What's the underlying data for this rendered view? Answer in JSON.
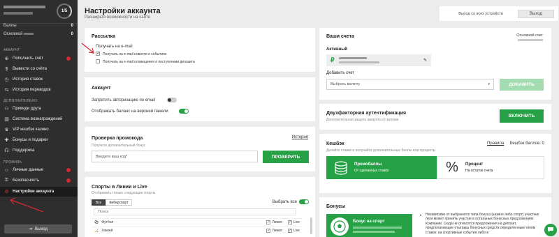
{
  "sidebar": {
    "level": "1/5",
    "rows": [
      {
        "label": "Баллы",
        "value": "0"
      },
      {
        "label": "Основной",
        "value": "0"
      }
    ],
    "sections": {
      "account": "АККАУНТ",
      "extra": "ДОПОЛНИТЕЛЬНО",
      "profile": "ПРОФИЛЬ"
    },
    "account_items": [
      {
        "label": "Пополнить счёт",
        "icon": "plus-circle-icon"
      },
      {
        "label": "Вывести со счёта",
        "icon": "dollar-icon"
      },
      {
        "label": "История ставок",
        "icon": "clock-icon"
      },
      {
        "label": "История переводов",
        "icon": "transfer-icon"
      }
    ],
    "extra_items": [
      {
        "label": "Приведи друга",
        "icon": "users-icon"
      },
      {
        "label": "Система вознаграждений",
        "icon": "chart-icon"
      },
      {
        "label": "VIP кешбэк казино",
        "icon": "vip-icon"
      },
      {
        "label": "Бонусы и подарки",
        "icon": "gift-icon"
      },
      {
        "label": "Поддержка",
        "icon": "support-icon"
      }
    ],
    "profile_items": [
      {
        "label": "Личные данные",
        "icon": "user-icon"
      },
      {
        "label": "Безопасность",
        "icon": "lock-icon"
      },
      {
        "label": "Настройки аккаунта",
        "icon": "settings-icon"
      }
    ],
    "logout": "Выход"
  },
  "header": {
    "title": "Настройки аккаунта",
    "subtitle": "Расширьте возможности на сайте",
    "exit_all_label": "Выход со всех устройств",
    "exit_button": "Выход"
  },
  "mailing": {
    "title": "Рассылка",
    "email_label": "Получать на e-mail",
    "options": [
      {
        "label": "Получать на e-mail новости о событиях",
        "checked": true
      },
      {
        "label": "Получать на e-mail оповещения о поступлении депозита",
        "checked": false
      }
    ]
  },
  "account": {
    "title": "Аккаунт",
    "toggles": [
      {
        "label": "Запретить авторизацию по email",
        "on": false
      },
      {
        "label": "Отображать баланс на верхней панели",
        "on": true
      }
    ]
  },
  "promo": {
    "title": "Проверка промокода",
    "history_link": "История",
    "subtitle": "Получите дополнительный бонус",
    "placeholder": "Введите ваш код*",
    "button": "ПРОВЕРИТЬ"
  },
  "sports": {
    "title": "Спорты в Линии и Live",
    "subtitle": "Отображать только следующие спорты",
    "tabs": [
      "Все",
      "Киберспорт"
    ],
    "select_all": "Выбрать все",
    "search_placeholder": "Поиск",
    "rows": [
      {
        "name": "Футбол",
        "line": "Линия",
        "live": "Live"
      },
      {
        "name": "Хоккей",
        "line": "Линия",
        "live": "Live"
      }
    ]
  },
  "accounts": {
    "title": "Ваши счета",
    "main_account": "Основной счет",
    "active_label": "Активный",
    "currency_symbol": "₽",
    "add_label": "Добавить счет",
    "select_placeholder": "Выбрать валюту",
    "add_button": "ДОБАВИТЬ"
  },
  "twofa": {
    "title": "Двухфакторная аутентификация",
    "subtitle": "Дополнительная защита аккаунта от взлома",
    "button": "ВКЛЮЧИТЬ"
  },
  "cashback": {
    "title": "Кешбэк",
    "rules_link": "Правила",
    "points_label": "Кешбэк баллов: 0",
    "subtitle": "Делайте ставки и получайте дополнительные баллы или проценты",
    "tiles": [
      {
        "title": "Промобаллы",
        "text": "От сделанных ставок"
      },
      {
        "title": "Процент",
        "text": "На остаток счета"
      }
    ]
  },
  "bonuses": {
    "title": "Бонусы",
    "sport_bonus": "Бонус на спорт",
    "description": "Независимо от выбранного типа бонуса (казино либо спорт) участник лиги может принять участие в остальных бонусных предложениях Компании. Сюда не относятся предложения на депозит, предполагающие отыгрыш бонусных средств определенным типом ставок: на спортивные события либо в"
  },
  "colors": {
    "accent": "#27a146",
    "sidebar": "#2e2e2e",
    "alert": "#d9272e"
  }
}
